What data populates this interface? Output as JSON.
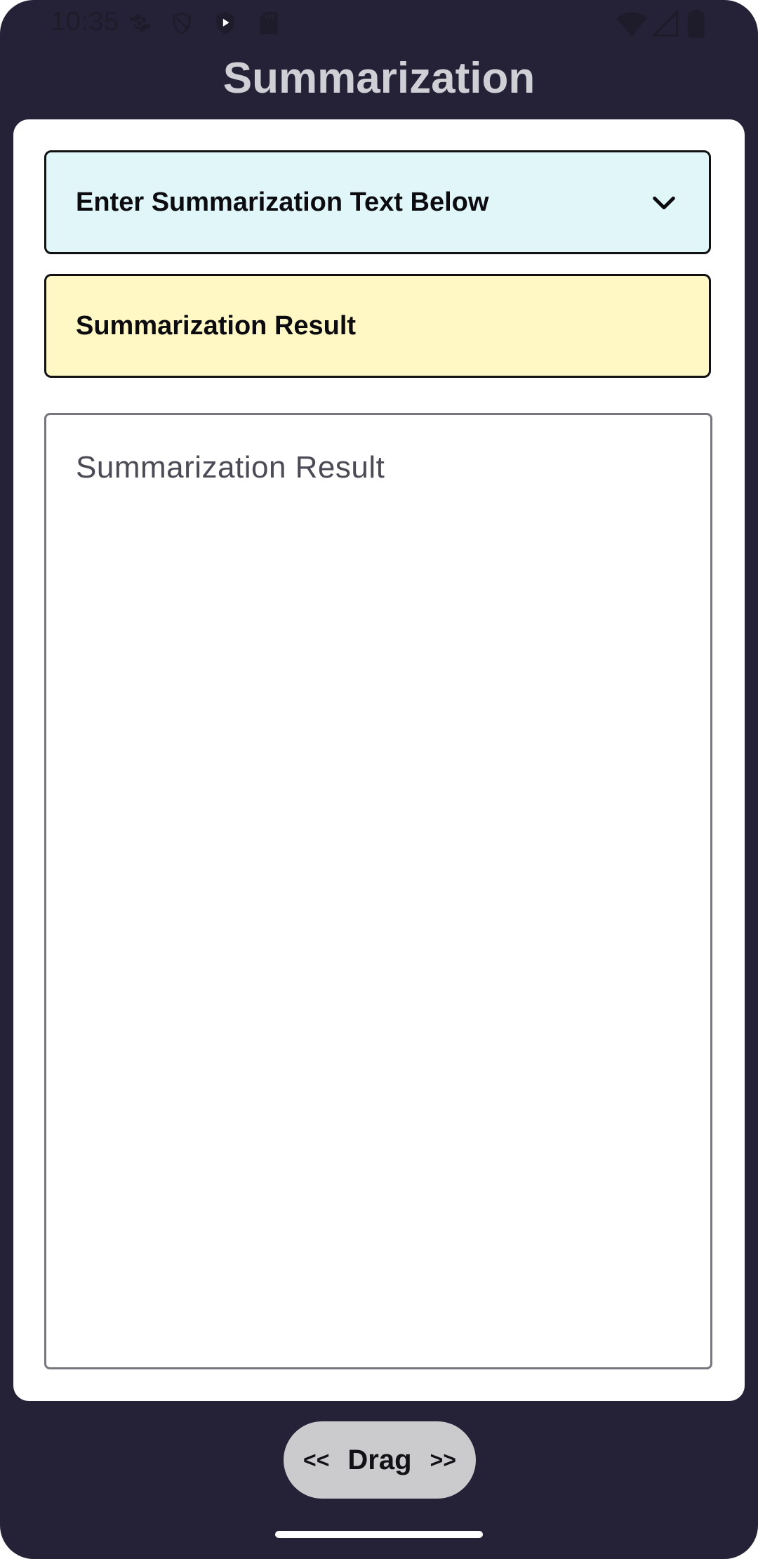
{
  "status_bar": {
    "time": "10:35",
    "left_icons": [
      "settings-icon",
      "shield-outline-icon",
      "shield-play-icon",
      "sd-card-icon"
    ],
    "right_icons": [
      "wifi-icon",
      "cellular-signal-icon",
      "battery-icon"
    ]
  },
  "header": {
    "title": "Summarization"
  },
  "input_panel": {
    "label": "Enter Summarization Text Below",
    "background": "#e0f6f8",
    "icon": "chevron-down-icon"
  },
  "result_panel": {
    "label": "Summarization Result",
    "background": "#fff8c4"
  },
  "result_field": {
    "placeholder": "Summarization Result"
  },
  "drag_control": {
    "left_arrow": "<<",
    "label": "Drag",
    "right_arrow": ">>"
  },
  "colors": {
    "app_background": "#252238",
    "title_color": "#cfcfd6",
    "card_background": "#ffffff"
  }
}
